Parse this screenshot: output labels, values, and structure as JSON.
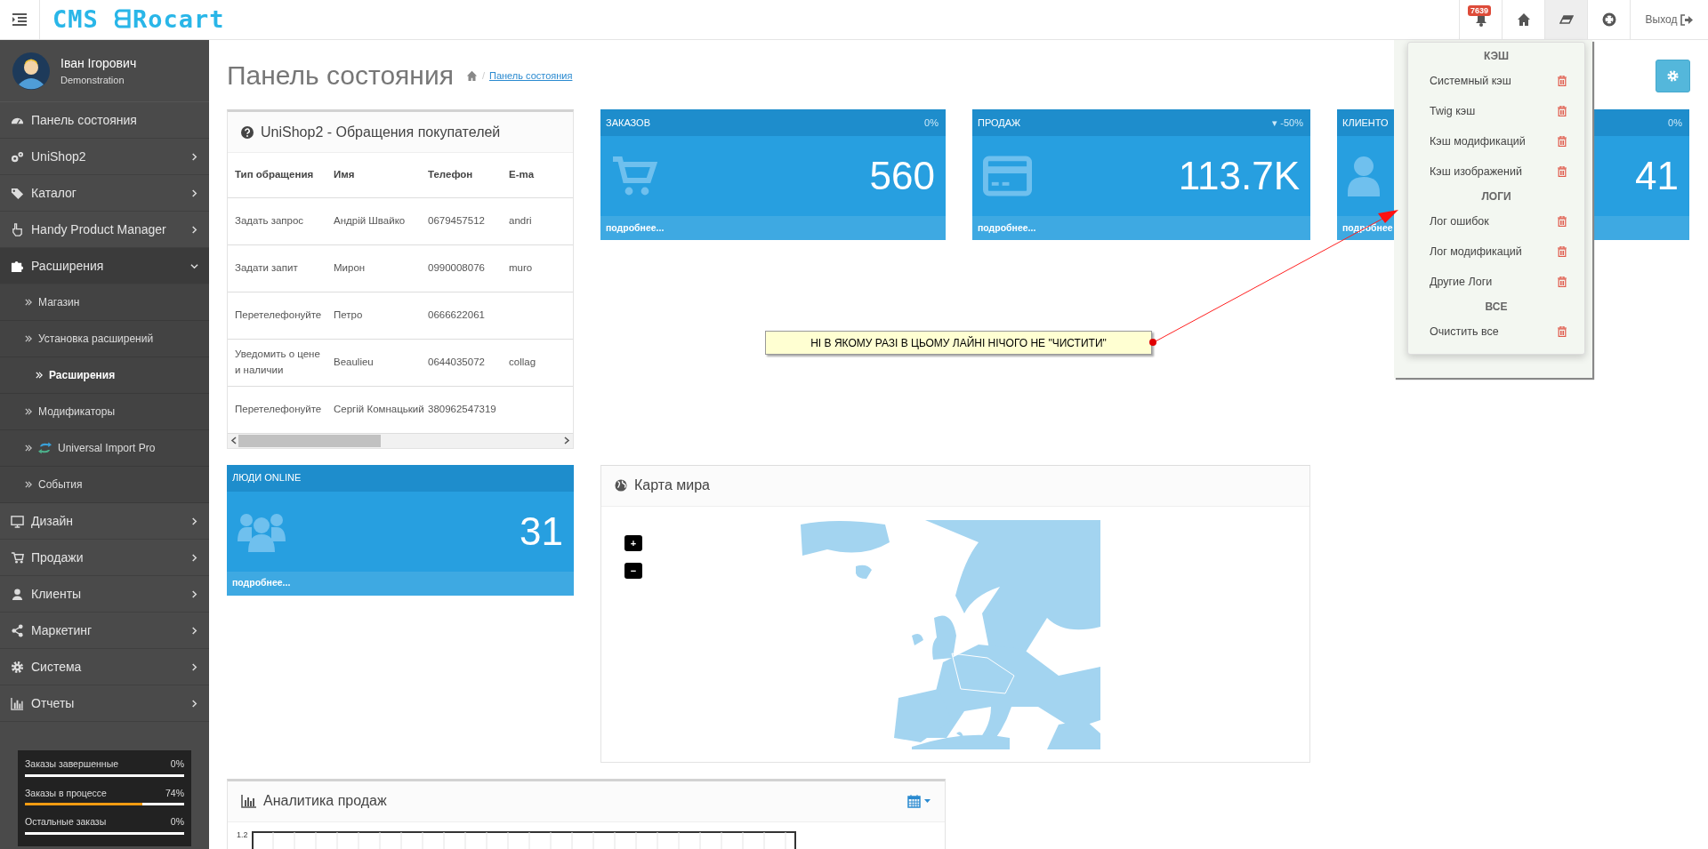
{
  "header": {
    "logo": "CMS ᗺRocart",
    "notifications_badge": "7639",
    "logout": "Выход"
  },
  "nav_buttons": [
    {
      "kind": "bell",
      "selected": false
    },
    {
      "kind": "home",
      "selected": false
    },
    {
      "kind": "eraser",
      "selected": true
    },
    {
      "kind": "lifebuoy",
      "selected": false
    }
  ],
  "user": {
    "name": "Іван Ігорович",
    "role": "Demonstration"
  },
  "sidebar": {
    "items": [
      {
        "label": "Панель состояния"
      },
      {
        "label": "UniShop2",
        "expanded": false
      },
      {
        "label": "Каталог",
        "expanded": false
      },
      {
        "label": "Handy Product Manager",
        "expanded": false
      },
      {
        "label": "Расширения",
        "expanded": true,
        "children": [
          {
            "label": "Магазин",
            "selected": false
          },
          {
            "label": "Установка расширений",
            "selected": false
          },
          {
            "label": "Расширения",
            "selected": true
          },
          {
            "label": "Модификаторы",
            "selected": false
          },
          {
            "label": "Universal Import Pro",
            "selected": false
          },
          {
            "label": "События",
            "selected": false
          }
        ]
      },
      {
        "label": "Дизайн",
        "expanded": false
      },
      {
        "label": "Продажи",
        "expanded": false
      },
      {
        "label": "Клиенты",
        "expanded": false
      },
      {
        "label": "Маркетинг",
        "expanded": false
      },
      {
        "label": "Система",
        "expanded": false
      },
      {
        "label": "Отчеты",
        "expanded": false
      }
    ]
  },
  "sidebar_stats": [
    {
      "label": "Заказы завершенные",
      "reading": "0%",
      "level": 0
    },
    {
      "label": "Заказы в процессе",
      "reading": "74%",
      "level": 0.74
    },
    {
      "label": "Остальные заказы",
      "reading": "0%",
      "level": 0
    }
  ],
  "page": {
    "title": "Панель состояния",
    "breadcrumb_separator": "/",
    "breadcrumb": [
      "Панель состояния"
    ]
  },
  "inquiries": {
    "title": "UniShop2 - Обращения покупателей",
    "columns": [
      "Тип обращения",
      "Имя",
      "Телефон",
      "E-ma"
    ],
    "rows": [
      {
        "cells": [
          "Задать запрос",
          "Андрій Швайко",
          "0679457512",
          "andri"
        ]
      },
      {
        "cells": [
          "Задати запит",
          "Мирон",
          "0990008076",
          "muro"
        ]
      },
      {
        "cells": [
          "Перетелефонуйте",
          "Петро",
          "0666622061"
        ]
      },
      {
        "cells": [
          "Уведомить о цене и наличии",
          "Beaulieu",
          "0644035072",
          "collag"
        ]
      },
      {
        "cells": [
          "Перетелефонуйте",
          "Сергій Комнацький",
          "380962547319"
        ]
      }
    ]
  },
  "stat_tiles": [
    {
      "title": "ЗАКАЗОВ",
      "change": "0%",
      "value": "560",
      "more": "подробнее..."
    },
    {
      "title": "ПРОДАЖ",
      "change": "▾ -50%",
      "value": "113.7K",
      "more": "подробнее..."
    },
    {
      "title": "КЛИЕНТО",
      "change": "0%",
      "value": "41",
      "more": "подробнее"
    }
  ],
  "online_tile": {
    "title": "ЛЮДИ ONLINE",
    "value": "31",
    "more": "подробнее..."
  },
  "world_map": {
    "title": "Карта мира",
    "zoom_in": "+",
    "zoom_out": "−"
  },
  "sales_analytics": {
    "title": "Аналитика продаж",
    "y_tick": "1.2"
  },
  "cache_menu": {
    "sections": [
      {
        "heading": "КЭШ",
        "items": [
          "Системный кэш",
          "Twig кэш",
          "Кэш модификаций",
          "Кэш изображений"
        ]
      },
      {
        "heading": "ЛОГИ",
        "items": [
          "Лог ошибок",
          "Лог модификаций",
          "Другие Логи"
        ]
      },
      {
        "heading": "ВСЕ",
        "items": [
          "Очистить все"
        ]
      }
    ]
  },
  "note": {
    "text": "НІ В ЯКОМУ РАЗІ В ЦЬОМУ ЛАЙНІ НІЧОГО НЕ \"ЧИСТИТИ\""
  }
}
